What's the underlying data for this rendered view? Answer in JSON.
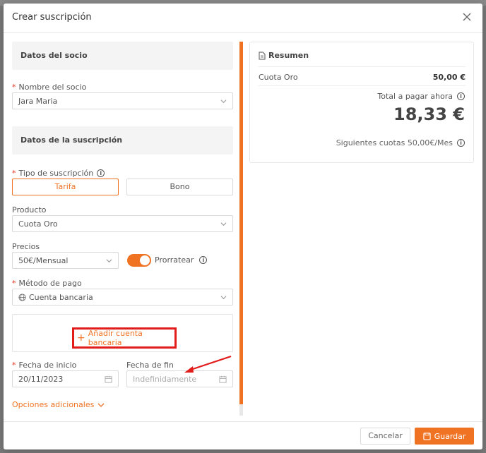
{
  "modal": {
    "title": "Crear suscripción"
  },
  "member_section": {
    "heading": "Datos del socio",
    "name_label": "Nombre del socio",
    "name_value": "Jara Maria"
  },
  "subscription_section": {
    "heading": "Datos de la suscripción",
    "type_label": "Tipo de suscripción",
    "type_options": [
      "Tarifa",
      "Bono"
    ],
    "type_selected": "Tarifa",
    "product_label": "Producto",
    "product_value": "Cuota Oro",
    "prices_label": "Precios",
    "prices_value": "50€/Mensual",
    "prorate_label": "Prorratear",
    "prorate_on": true,
    "payment_label": "Método de pago",
    "payment_value": "Cuenta bancaria",
    "add_bank_label": "Añadir cuenta bancaria",
    "start_label": "Fecha de inicio",
    "start_value": "20/11/2023",
    "end_label": "Fecha de fin",
    "end_placeholder": "Indefinidamente",
    "more_options_label": "Opciones adicionales"
  },
  "summary": {
    "title": "Resumen",
    "line_item_label": "Cuota Oro",
    "line_item_amount": "50,00 €",
    "total_label": "Total a pagar ahora",
    "total_value": "18,33 €",
    "next_label": "Siguientes cuotas 50,00€/Mes"
  },
  "footer": {
    "cancel_label": "Cancelar",
    "save_label": "Guardar"
  },
  "colors": {
    "accent": "#f07324",
    "highlight_annotation": "#e21b1b"
  }
}
